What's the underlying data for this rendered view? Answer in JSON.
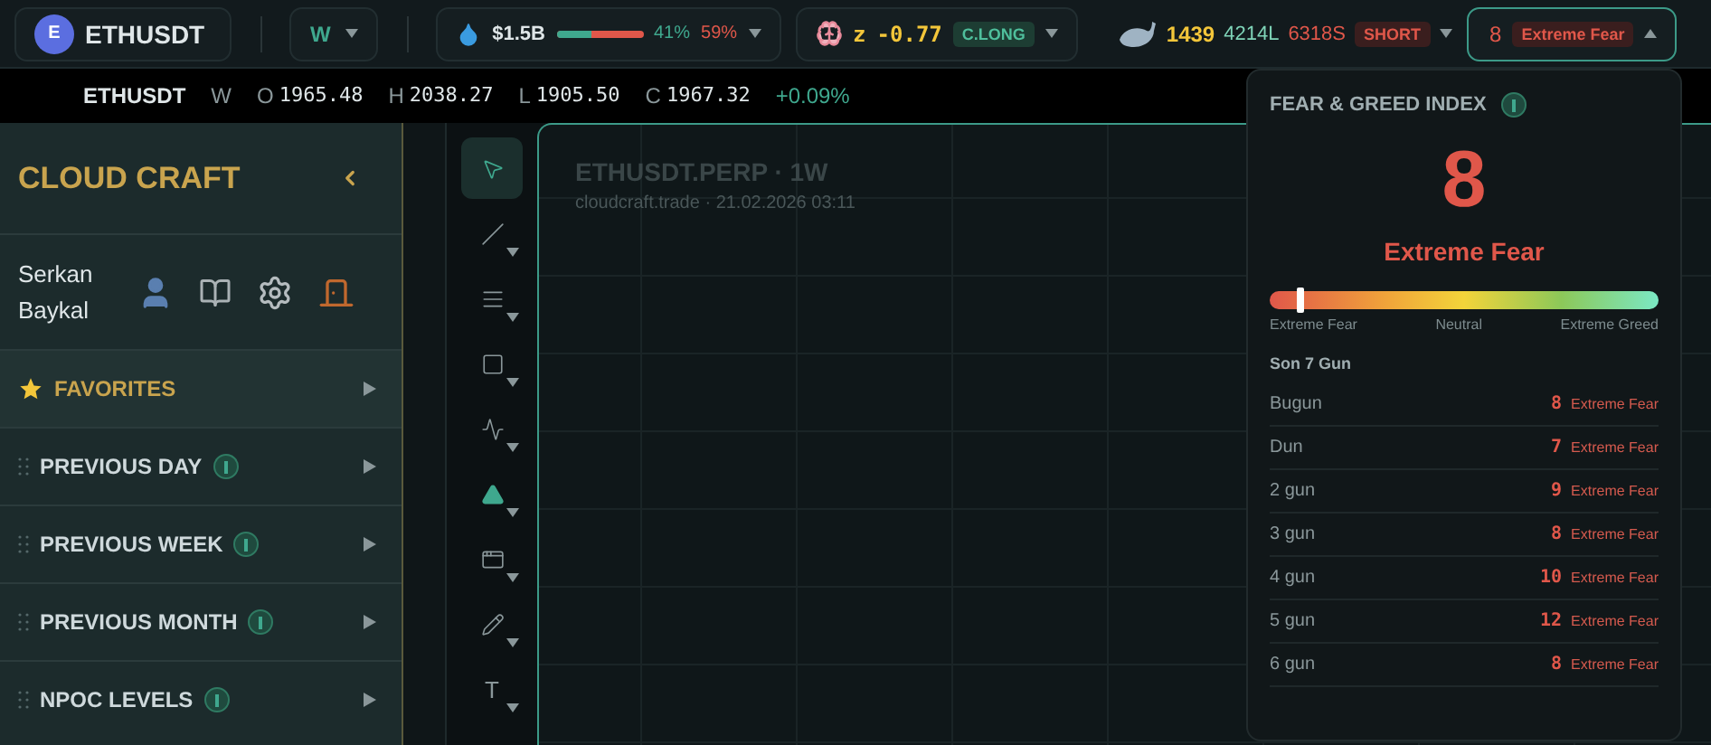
{
  "top_bar": {
    "symbol": {
      "icon_letter": "E",
      "label": "ETHUSDT"
    },
    "timeframe": "W",
    "liquidity": {
      "amount": "$1.5B",
      "level": 0.41,
      "long_pct": "41%",
      "short_pct": "59%"
    },
    "sentiment": {
      "label": "z",
      "value": "-0.77",
      "badge": "C.LONG"
    },
    "whales": {
      "count": "1439",
      "long": "4214L",
      "short": "6318S",
      "badge": "SHORT"
    },
    "fear_greed": {
      "value": "8",
      "label": "Extreme Fear",
      "expanded": true
    }
  },
  "ticker": {
    "symbol": "ETHUSDT",
    "timeframe": "W",
    "ohlc": [
      {
        "key": "O",
        "value": "1965.48"
      },
      {
        "key": "H",
        "value": "2038.27"
      },
      {
        "key": "L",
        "value": "1905.50"
      },
      {
        "key": "C",
        "value": "1967.32"
      }
    ],
    "change": "+0.09%"
  },
  "sidebar": {
    "title": "CLOUD CRAFT",
    "user": "Serkan Baykal",
    "sections": [
      {
        "kind": "favorite",
        "label": "FAVORITES",
        "info": false
      },
      {
        "kind": "level",
        "label": "PREVIOUS DAY",
        "info": true
      },
      {
        "kind": "level",
        "label": "PREVIOUS WEEK",
        "info": true
      },
      {
        "kind": "level",
        "label": "PREVIOUS MONTH",
        "info": true
      },
      {
        "kind": "level",
        "label": "NPOC LEVELS",
        "info": true
      }
    ]
  },
  "tools": [
    {
      "kind": "cursor",
      "selected": true
    },
    {
      "kind": "line",
      "selected": false
    },
    {
      "kind": "hlines",
      "selected": false
    },
    {
      "kind": "rect",
      "selected": false
    },
    {
      "kind": "wave",
      "selected": false
    },
    {
      "kind": "marker",
      "selected": false
    },
    {
      "kind": "window",
      "selected": false
    },
    {
      "kind": "pencil",
      "selected": false
    },
    {
      "kind": "text",
      "label": "T",
      "selected": false
    }
  ],
  "chart": {
    "title": "ETHUSDT.PERP · 1W",
    "subtitle": "cloudcraft.trade · 21.02.2026 03:11"
  },
  "fear_greed_panel": {
    "title": "FEAR & GREED INDEX",
    "value": "8",
    "label": "Extreme Fear",
    "level": 0.08,
    "scale": [
      "Extreme Fear",
      "Neutral",
      "Extreme Greed"
    ],
    "history_title": "Son 7 Gun",
    "history": [
      {
        "day": "Bugun",
        "value": "8",
        "label": "Extreme Fear"
      },
      {
        "day": "Dun",
        "value": "7",
        "label": "Extreme Fear"
      },
      {
        "day": "2 gun",
        "value": "9",
        "label": "Extreme Fear"
      },
      {
        "day": "3 gun",
        "value": "8",
        "label": "Extreme Fear"
      },
      {
        "day": "4 gun",
        "value": "10",
        "label": "Extreme Fear"
      },
      {
        "day": "5 gun",
        "value": "12",
        "label": "Extreme Fear"
      },
      {
        "day": "6 gun",
        "value": "8",
        "label": "Extreme Fear"
      }
    ]
  }
}
